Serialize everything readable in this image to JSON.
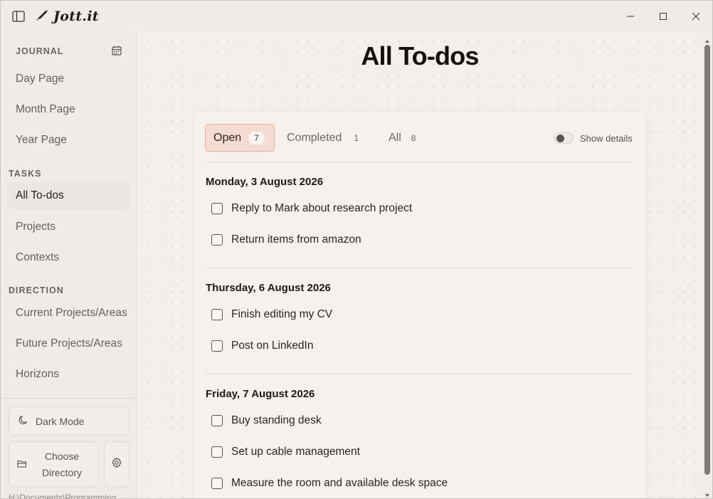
{
  "app": {
    "name": "Jott.it"
  },
  "sidebar": {
    "journal_heading": "JOURNAL",
    "journal_items": [
      {
        "label": "Day Page"
      },
      {
        "label": "Month Page"
      },
      {
        "label": "Year Page"
      }
    ],
    "tasks_heading": "TASKS",
    "tasks_items": [
      {
        "label": "All To-dos",
        "active": true
      },
      {
        "label": "Projects"
      },
      {
        "label": "Contexts"
      }
    ],
    "direction_heading": "DIRECTION",
    "direction_items": [
      {
        "label": "Current Projects/Areas"
      },
      {
        "label": "Future Projects/Areas"
      },
      {
        "label": "Horizons"
      }
    ],
    "dark_mode_label": "Dark Mode",
    "choose_directory_label": "Choose Directory",
    "directory_path": "H:\\Documents\\Programming"
  },
  "main": {
    "title": "All To-dos",
    "tabs": [
      {
        "label": "Open",
        "count": "7",
        "active": true
      },
      {
        "label": "Completed",
        "count": "1"
      },
      {
        "label": "All",
        "count": "8"
      }
    ],
    "show_details_label": "Show details",
    "show_details_on": false,
    "groups": [
      {
        "date": "Monday, 3 August 2026",
        "items": [
          "Reply to Mark about research project",
          "Return items from amazon"
        ]
      },
      {
        "date": "Thursday, 6 August 2026",
        "items": [
          "Finish editing my CV",
          "Post on LinkedIn"
        ]
      },
      {
        "date": "Friday, 7 August 2026",
        "items": [
          "Buy standing desk",
          "Set up cable management",
          "Measure the room and available desk space"
        ]
      }
    ]
  },
  "colors": {
    "accent_tab_bg": "#f5dcd3",
    "accent_tab_border": "#e6ad9c",
    "background": "#f3efec"
  }
}
